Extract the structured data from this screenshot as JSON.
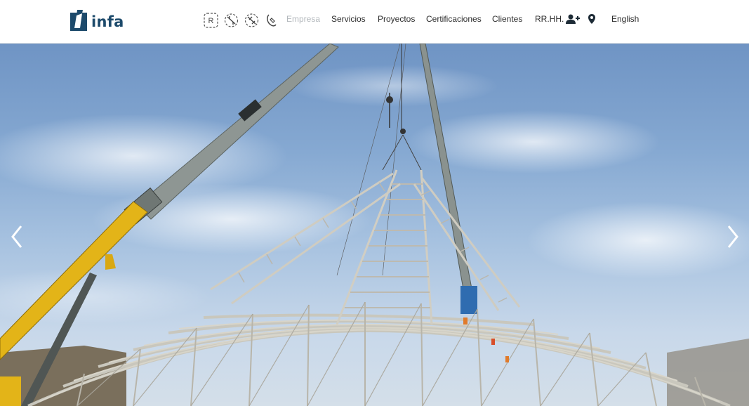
{
  "brand": {
    "name": "infa"
  },
  "certifications": [
    {
      "icon": "registered-cert-icon"
    },
    {
      "icon": "quality-cert-icon"
    },
    {
      "icon": "environment-cert-icon"
    },
    {
      "icon": "safety-cert-icon"
    }
  ],
  "menu": {
    "empresa": "Empresa",
    "servicios": "Servicios",
    "proyectos": "Proyectos",
    "certificaciones": "Certificaciones",
    "clientes": "Clientes",
    "rrhh": "RR.HH.",
    "language": "English"
  },
  "menu_icons": {
    "rrhh": "user-plus-icon",
    "location": "map-pin-icon"
  },
  "colors": {
    "brand_navy": "#1d4a6b",
    "active_menu": "#b3b8bc",
    "menu_text": "#2c2c2c",
    "crane_yellow": "#e3b418"
  },
  "slider": {
    "prev_icon": "chevron-left-icon",
    "next_icon": "chevron-right-icon"
  }
}
